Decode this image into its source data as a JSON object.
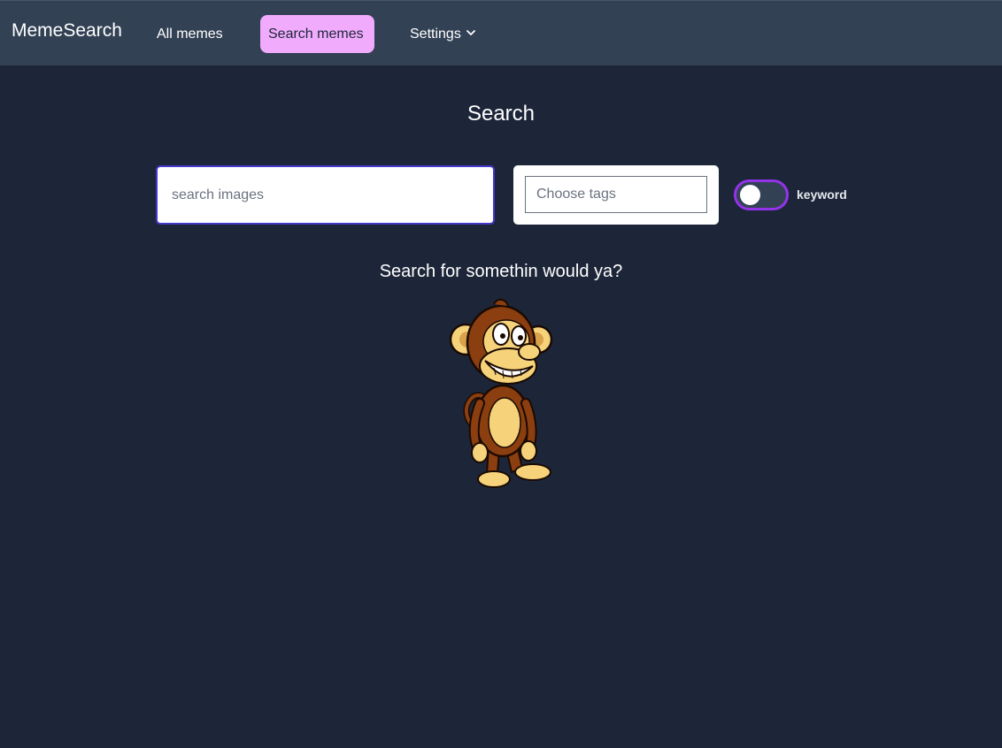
{
  "nav": {
    "brand": "MemeSearch",
    "all_memes": "All memes",
    "search_memes": "Search memes",
    "settings": "Settings"
  },
  "main": {
    "title": "Search",
    "search_placeholder": "search images",
    "tags_placeholder": "Choose tags",
    "toggle_label": "keyword",
    "toggle_on": false,
    "empty_message": "Search for somethin would ya?"
  },
  "icons": {
    "settings_chevron": "chevron-down-icon",
    "illustration": "monkey-illustration"
  },
  "colors": {
    "background": "#1d2639",
    "navbar": "#334155",
    "active_tab": "#f0abfc",
    "search_border": "#4338ca",
    "toggle_border": "#9333ea"
  }
}
